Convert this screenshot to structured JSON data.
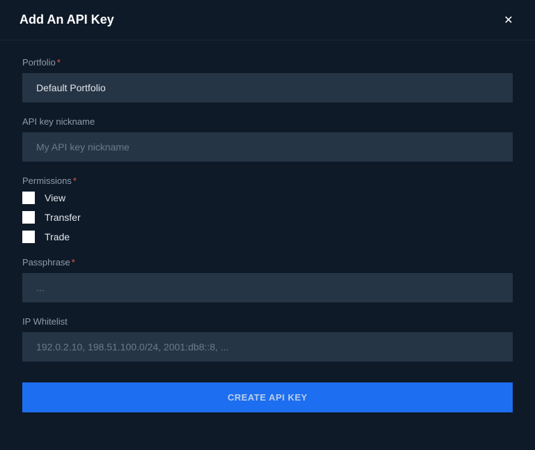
{
  "modal": {
    "title": "Add An API Key"
  },
  "portfolio": {
    "label": "Portfolio",
    "value": "Default Portfolio"
  },
  "nickname": {
    "label": "API key nickname",
    "placeholder": "My API key nickname"
  },
  "permissions": {
    "label": "Permissions",
    "options": {
      "view": "View",
      "transfer": "Transfer",
      "trade": "Trade"
    }
  },
  "passphrase": {
    "label": "Passphrase",
    "placeholder": "..."
  },
  "ipwhitelist": {
    "label": "IP Whitelist",
    "placeholder": "192.0.2.10, 198.51.100.0/24, 2001:db8::8, ..."
  },
  "submit": {
    "label": "CREATE API KEY"
  }
}
